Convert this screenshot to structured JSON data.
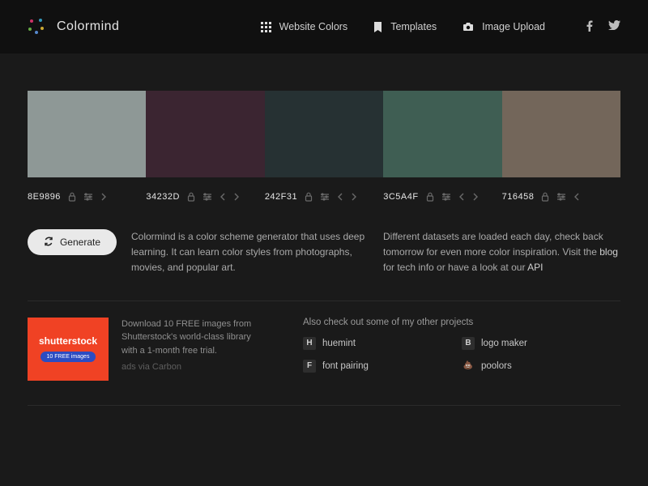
{
  "brand": "Colormind",
  "nav": {
    "website_colors": "Website Colors",
    "templates": "Templates",
    "image_upload": "Image Upload"
  },
  "palette": [
    {
      "hex": "8E9896",
      "color": "#8e9896"
    },
    {
      "hex": "34232D",
      "color": "#3b2531"
    },
    {
      "hex": "242F31",
      "color": "#263133"
    },
    {
      "hex": "3C5A4F",
      "color": "#3f5e53"
    },
    {
      "hex": "716458",
      "color": "#73665a"
    }
  ],
  "generate_label": "Generate",
  "desc1": "Colormind is a color scheme generator that uses deep learning. It can learn color styles from photographs, movies, and popular art.",
  "desc2_a": "Different datasets are loaded each day, check back tomorrow for even more color inspiration. Visit the ",
  "desc2_link1": "blog",
  "desc2_b": " for tech info or have a look at our ",
  "desc2_link2": "API",
  "ad": {
    "logo": "shutterstock",
    "pill": "10 FREE images",
    "text": "Download 10 FREE images from Shutterstock's world-class library with a 1-month free trial.",
    "via": "ads via Carbon"
  },
  "projects_title": "Also check out some of my other projects",
  "projects": {
    "huemint": "huemint",
    "logomaker": "logo maker",
    "fontpairing": "font pairing",
    "poolors": "poolors"
  }
}
